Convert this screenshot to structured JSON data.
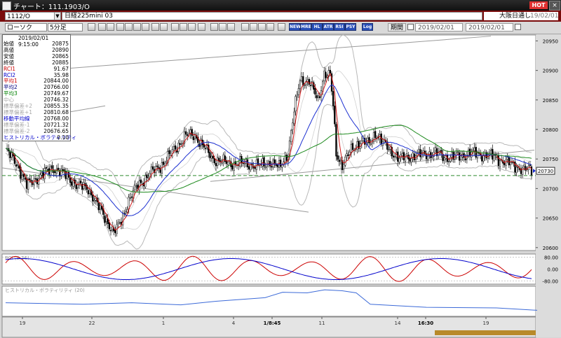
{
  "window": {
    "title": "チャート：111.1903/O",
    "hot_label": "HOT",
    "close_glyph": "×"
  },
  "header": {
    "code": "1112/O",
    "instrument": "日経225mini 03",
    "session": "大阪日通し",
    "session_date": "19/02/01"
  },
  "toolbar": {
    "chart_type": "ローソク",
    "interval": "5分足",
    "period_label": "期間",
    "date_from": "2019/02/01",
    "date_to": "2019/02/01",
    "buttons": [
      "NEW",
      "MRE",
      "HL",
      "ATR",
      "RSI",
      "PSY",
      "Log"
    ]
  },
  "info_panel": {
    "datetime": "2019/02/01 9:15:00",
    "rows": [
      {
        "label": "始値",
        "value": "20875",
        "color": "#000000"
      },
      {
        "label": "高値",
        "value": "20890",
        "color": "#000000"
      },
      {
        "label": "安値",
        "value": "20865",
        "color": "#000000"
      },
      {
        "label": "終値",
        "value": "20885",
        "color": "#000000"
      },
      {
        "label": "RCI1",
        "value": "91.67",
        "color": "#cc0000"
      },
      {
        "label": "RCI2",
        "value": "35.98",
        "color": "#0000cc"
      },
      {
        "label": "平均1",
        "value": "20844.00",
        "color": "#cc0000"
      },
      {
        "label": "平均2",
        "value": "20766.00",
        "color": "#000080"
      },
      {
        "label": "平均3",
        "value": "20749.67",
        "color": "#008000"
      },
      {
        "label": "中心",
        "value": "20746.32",
        "color": "#a8a8a8"
      },
      {
        "label": "標準偏差+2",
        "value": "20855.35",
        "color": "#a8a8a8"
      },
      {
        "label": "標準偏差+1",
        "value": "20810.68",
        "color": "#a8a8a8"
      },
      {
        "label": "移動平均線",
        "value": "20768.00",
        "color": "#0000cc"
      },
      {
        "label": "標準偏差-1",
        "value": "20721.32",
        "color": "#a8a8a8"
      },
      {
        "label": "標準偏差-2",
        "value": "20676.65",
        "color": "#a8a8a8"
      },
      {
        "label": "ヒストリカル・ボラティリティ",
        "value": "0.10",
        "color": "#0000cc"
      }
    ]
  },
  "chart_data": [
    {
      "type": "candlestick",
      "title": "",
      "y_ticks": [
        20600,
        20650,
        20700,
        20750,
        20800,
        20850,
        20900,
        20950
      ],
      "ylim": [
        20595,
        20960
      ],
      "current_price": "20730",
      "reference_price": 20722,
      "x_ticks": [
        "19",
        "22",
        "1",
        "4",
        "1/8:45",
        "11",
        "14",
        "16:30",
        "19"
      ],
      "overlays": [
        "平均1",
        "平均2",
        "平均3",
        "ボリンジャーバンド"
      ],
      "grid": false
    },
    {
      "type": "line",
      "title": "RCI (9,26)",
      "y_ticks": [
        "80.00",
        "0.00",
        "-80.00"
      ],
      "ylim": [
        -100,
        100
      ],
      "series": [
        {
          "name": "RCI1",
          "color": "#cc0000"
        },
        {
          "name": "RCI2",
          "color": "#0000cc"
        }
      ]
    },
    {
      "type": "line",
      "title": "ヒストリカル・ボラティリティ (20)",
      "series": [
        {
          "name": "ヒストリカル・ボラティリティ",
          "color": "#3c6ad8"
        }
      ]
    }
  ]
}
